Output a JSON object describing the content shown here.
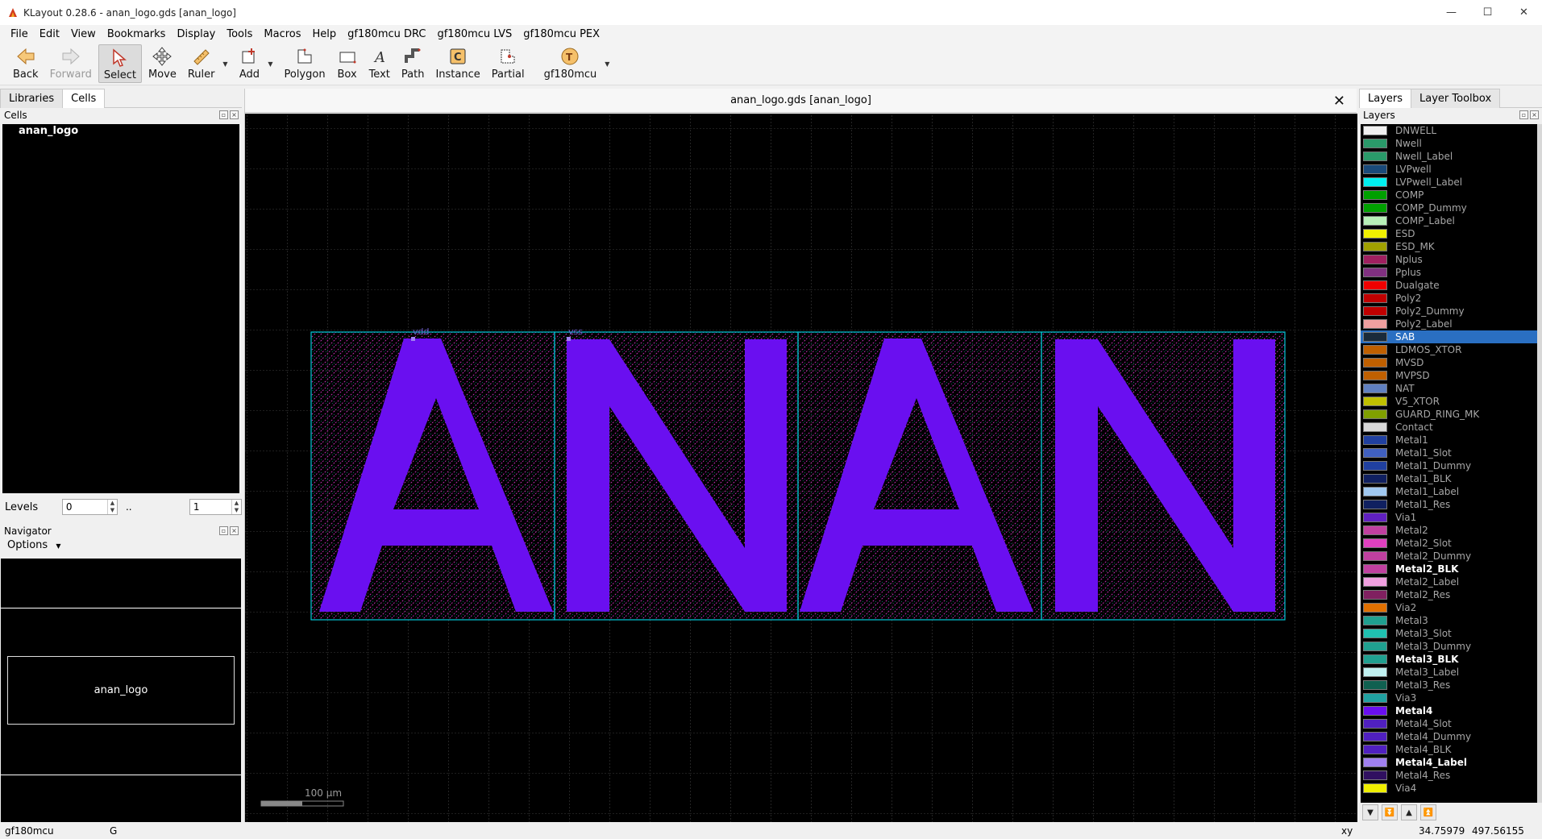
{
  "window": {
    "title": "KLayout 0.28.6 - anan_logo.gds [anan_logo]",
    "controls": [
      "—",
      "☐",
      "✕"
    ]
  },
  "menu": [
    "File",
    "Edit",
    "View",
    "Bookmarks",
    "Display",
    "Tools",
    "Macros",
    "Help",
    "gf180mcu DRC",
    "gf180mcu LVS",
    "gf180mcu PEX"
  ],
  "toolbar": {
    "back": "Back",
    "forward": "Forward",
    "select": "Select",
    "move": "Move",
    "ruler": "Ruler",
    "add": "Add",
    "polygon": "Polygon",
    "box": "Box",
    "text": "Text",
    "path": "Path",
    "instance": "Instance",
    "partial": "Partial",
    "tech": "gf180mcu"
  },
  "left": {
    "tabs": [
      "Libraries",
      "Cells"
    ],
    "cells_title": "Cells",
    "cell": "anan_logo",
    "levels_label": "Levels",
    "level_from": "0",
    "level_sep": "..",
    "level_to": "1",
    "navigator_title": "Navigator",
    "options": "Options",
    "nav_cell": "anan_logo"
  },
  "view": {
    "title": "anan_logo.gds [anan_logo]",
    "close": "✕",
    "text_labels": [
      "vdd",
      "vss"
    ],
    "letters": "ANAN",
    "scale_label": "100 µm",
    "fill_color": "#6a0ff0",
    "outline_color": "#00c8d8"
  },
  "right": {
    "tabs": [
      "Layers",
      "Layer Toolbox"
    ],
    "layers_title": "Layers",
    "layers": [
      {
        "name": "DNWELL",
        "color": "#f0f0f0",
        "visible": false
      },
      {
        "name": "Nwell",
        "color": "#2a9a6a",
        "visible": false
      },
      {
        "name": "Nwell_Label",
        "color": "#2a9a6a",
        "visible": false
      },
      {
        "name": "LVPwell",
        "color": "#1a4a7a",
        "visible": false
      },
      {
        "name": "LVPwell_Label",
        "color": "#00f0f0",
        "visible": false
      },
      {
        "name": "COMP",
        "color": "#00a000",
        "visible": false
      },
      {
        "name": "COMP_Dummy",
        "color": "#00a000",
        "visible": false
      },
      {
        "name": "COMP_Label",
        "color": "#b8f0b8",
        "visible": false
      },
      {
        "name": "ESD",
        "color": "#f0f000",
        "visible": false
      },
      {
        "name": "ESD_MK",
        "color": "#a0a000",
        "visible": false
      },
      {
        "name": "Nplus",
        "color": "#a02060",
        "visible": false
      },
      {
        "name": "Pplus",
        "color": "#803080",
        "visible": false
      },
      {
        "name": "Dualgate",
        "color": "#f00000",
        "visible": false
      },
      {
        "name": "Poly2",
        "color": "#c00000",
        "visible": false
      },
      {
        "name": "Poly2_Dummy",
        "color": "#c00000",
        "visible": false
      },
      {
        "name": "Poly2_Label",
        "color": "#f0a0a0",
        "visible": false
      },
      {
        "name": "SAB",
        "color": "#1a2a3a",
        "visible": false,
        "selected": true
      },
      {
        "name": "LDMOS_XTOR",
        "color": "#c06000",
        "visible": false
      },
      {
        "name": "MVSD",
        "color": "#c06000",
        "visible": false
      },
      {
        "name": "MVPSD",
        "color": "#c06000",
        "visible": false
      },
      {
        "name": "NAT",
        "color": "#6080c0",
        "visible": false
      },
      {
        "name": "V5_XTOR",
        "color": "#c0c000",
        "visible": false
      },
      {
        "name": "GUARD_RING_MK",
        "color": "#80a000",
        "visible": false
      },
      {
        "name": "Contact",
        "color": "#d8d8d8",
        "visible": false
      },
      {
        "name": "Metal1",
        "color": "#2040a0",
        "visible": false
      },
      {
        "name": "Metal1_Slot",
        "color": "#4060c0",
        "visible": false
      },
      {
        "name": "Metal1_Dummy",
        "color": "#2040a0",
        "visible": false
      },
      {
        "name": "Metal1_BLK",
        "color": "#102060",
        "visible": false
      },
      {
        "name": "Metal1_Label",
        "color": "#a0c8f0",
        "visible": false
      },
      {
        "name": "Metal1_Res",
        "color": "#102060",
        "visible": false
      },
      {
        "name": "Via1",
        "color": "#6020c0",
        "visible": false
      },
      {
        "name": "Metal2",
        "color": "#c040a0",
        "visible": false
      },
      {
        "name": "Metal2_Slot",
        "color": "#e040c0",
        "visible": false
      },
      {
        "name": "Metal2_Dummy",
        "color": "#c040a0",
        "visible": false
      },
      {
        "name": "Metal2_BLK",
        "color": "#c040a0",
        "visible": true
      },
      {
        "name": "Metal2_Label",
        "color": "#f0a0e0",
        "visible": false
      },
      {
        "name": "Metal2_Res",
        "color": "#802060",
        "visible": false
      },
      {
        "name": "Via2",
        "color": "#e07000",
        "visible": false
      },
      {
        "name": "Metal3",
        "color": "#20a090",
        "visible": false
      },
      {
        "name": "Metal3_Slot",
        "color": "#20c0b0",
        "visible": false
      },
      {
        "name": "Metal3_Dummy",
        "color": "#20a090",
        "visible": false
      },
      {
        "name": "Metal3_BLK",
        "color": "#20a090",
        "visible": true
      },
      {
        "name": "Metal3_Label",
        "color": "#c0f0f0",
        "visible": false
      },
      {
        "name": "Metal3_Res",
        "color": "#106050",
        "visible": false
      },
      {
        "name": "Via3",
        "color": "#20a0a0",
        "visible": false
      },
      {
        "name": "Metal4",
        "color": "#6a0ff0",
        "visible": true
      },
      {
        "name": "Metal4_Slot",
        "color": "#5020c0",
        "visible": false
      },
      {
        "name": "Metal4_Dummy",
        "color": "#5020c0",
        "visible": false
      },
      {
        "name": "Metal4_BLK",
        "color": "#5020c0",
        "visible": false
      },
      {
        "name": "Metal4_Label",
        "color": "#a080f0",
        "visible": true
      },
      {
        "name": "Metal4_Res",
        "color": "#301060",
        "visible": false
      },
      {
        "name": "Via4",
        "color": "#f0f000",
        "visible": false
      }
    ],
    "tool_icons": [
      "move-down-icon",
      "move-down-alt-icon",
      "move-up-icon",
      "move-top-icon"
    ]
  },
  "status": {
    "tech": "gf180mcu",
    "grid": "G",
    "xy_label": "xy",
    "x": "34.75979",
    "y": "497.56155"
  }
}
